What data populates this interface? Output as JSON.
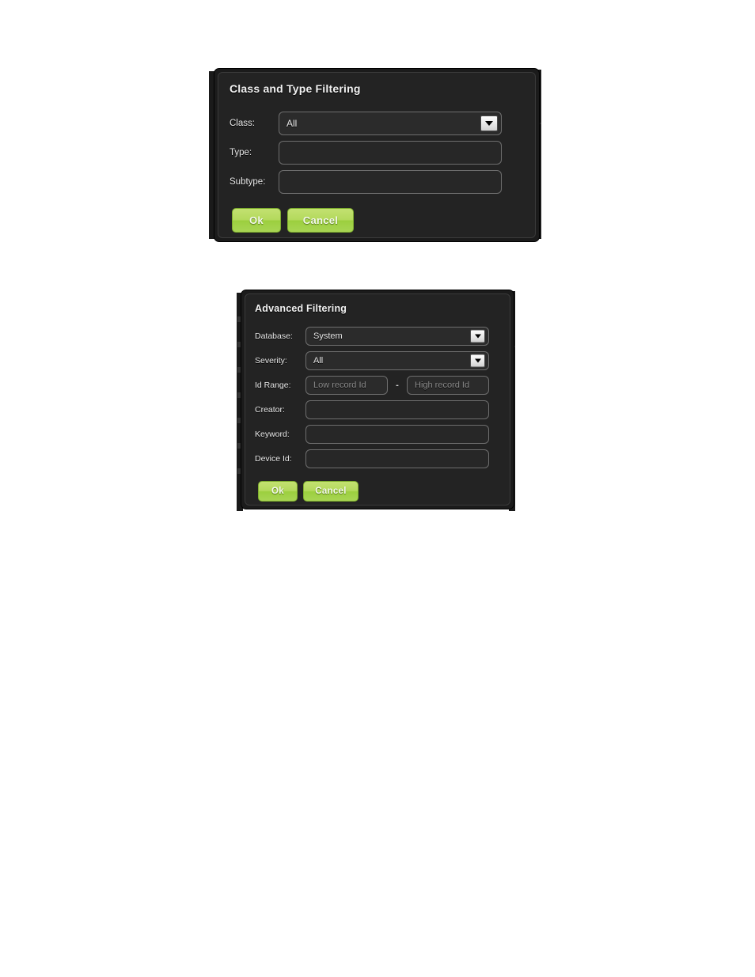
{
  "page": {
    "background": "#ffffff"
  },
  "colors": {
    "dialog_bg": "#232323",
    "dialog_border": "#3a3a3a",
    "field_bg": "#2b2b2b",
    "field_border": "#6e6e6e",
    "button_green": "#aed760",
    "button_border": "#7fae2f",
    "text": "#e8e8e8",
    "placeholder": "#8a8a8a"
  },
  "dialogs": [
    {
      "id": "class-and-type-filtering",
      "title": "Class and Type Filtering",
      "fields": [
        {
          "label": "Class:",
          "type": "select",
          "value": "All",
          "placeholder": ""
        },
        {
          "label": "Type:",
          "type": "text",
          "value": "",
          "placeholder": ""
        },
        {
          "label": "Subtype:",
          "type": "text",
          "value": "",
          "placeholder": ""
        }
      ],
      "buttons": [
        {
          "label": "Ok"
        },
        {
          "label": "Cancel"
        }
      ]
    },
    {
      "id": "advanced-filtering",
      "title": "Advanced Filtering",
      "fields": [
        {
          "label": "Database:",
          "type": "select",
          "value": "System",
          "placeholder": ""
        },
        {
          "label": "Severity:",
          "type": "select",
          "value": "All",
          "placeholder": ""
        },
        {
          "label": "Id Range:",
          "type": "range",
          "value": "",
          "placeholder_low": "Low record Id",
          "placeholder_high": "High record Id",
          "separator": "-"
        },
        {
          "label": "Creator:",
          "type": "text",
          "value": "",
          "placeholder": ""
        },
        {
          "label": "Keyword:",
          "type": "text",
          "value": "",
          "placeholder": ""
        },
        {
          "label": "Device Id:",
          "type": "text",
          "value": "",
          "placeholder": ""
        }
      ],
      "buttons": [
        {
          "label": "Ok"
        },
        {
          "label": "Cancel"
        }
      ]
    }
  ]
}
